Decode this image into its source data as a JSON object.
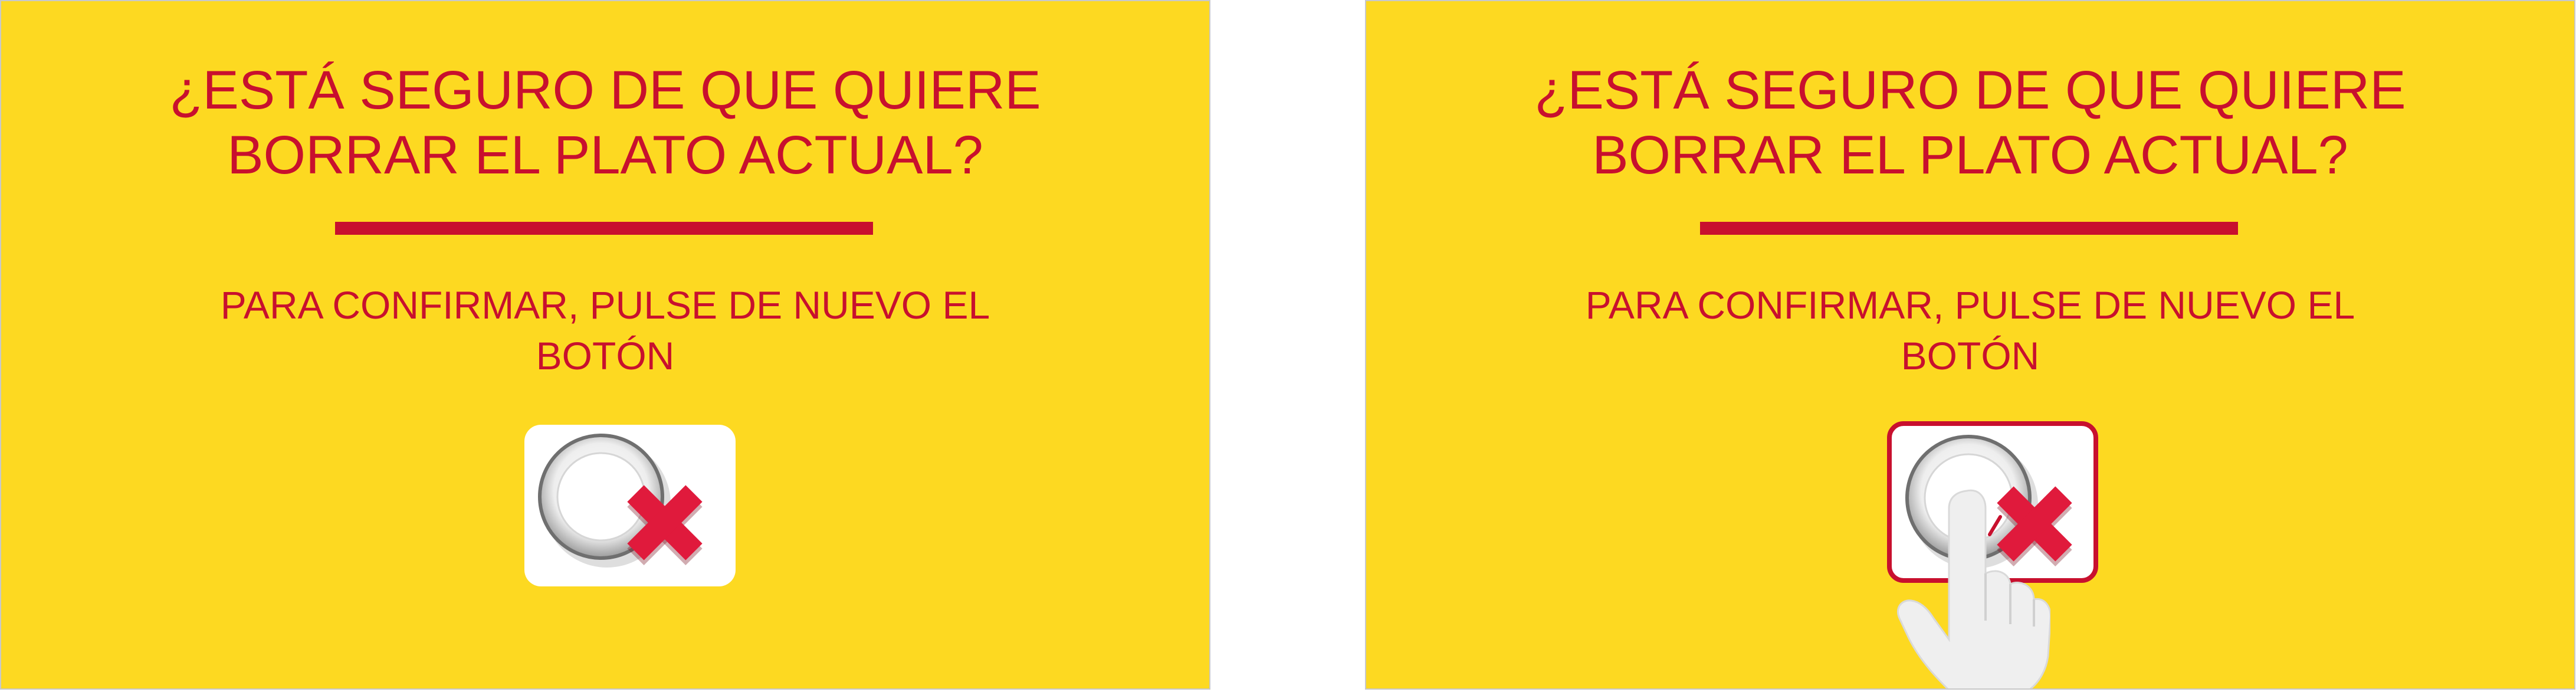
{
  "screens": [
    {
      "title_lines": [
        "¿ESTÁ SEGURO DE QUE QUIERE",
        "BORRAR EL PLATO ACTUAL?"
      ],
      "instruction_lines": [
        "PARA CONFIRMAR, PULSE DE NUEVO EL",
        "BOTÓN"
      ],
      "button_icon": "delete-plate-icon",
      "state": "idle"
    },
    {
      "title_lines": [
        "¿ESTÁ SEGURO DE QUE QUIERE",
        "BORRAR EL PLATO ACTUAL?"
      ],
      "instruction_lines": [
        "PARA CONFIRMAR, PULSE DE NUEVO EL",
        "BOTÓN"
      ],
      "button_icon": "delete-plate-icon",
      "state": "pressed"
    }
  ],
  "colors": {
    "background": "#FDD921",
    "accent": "#C8102E",
    "button_bg": "#FFFFFF"
  }
}
